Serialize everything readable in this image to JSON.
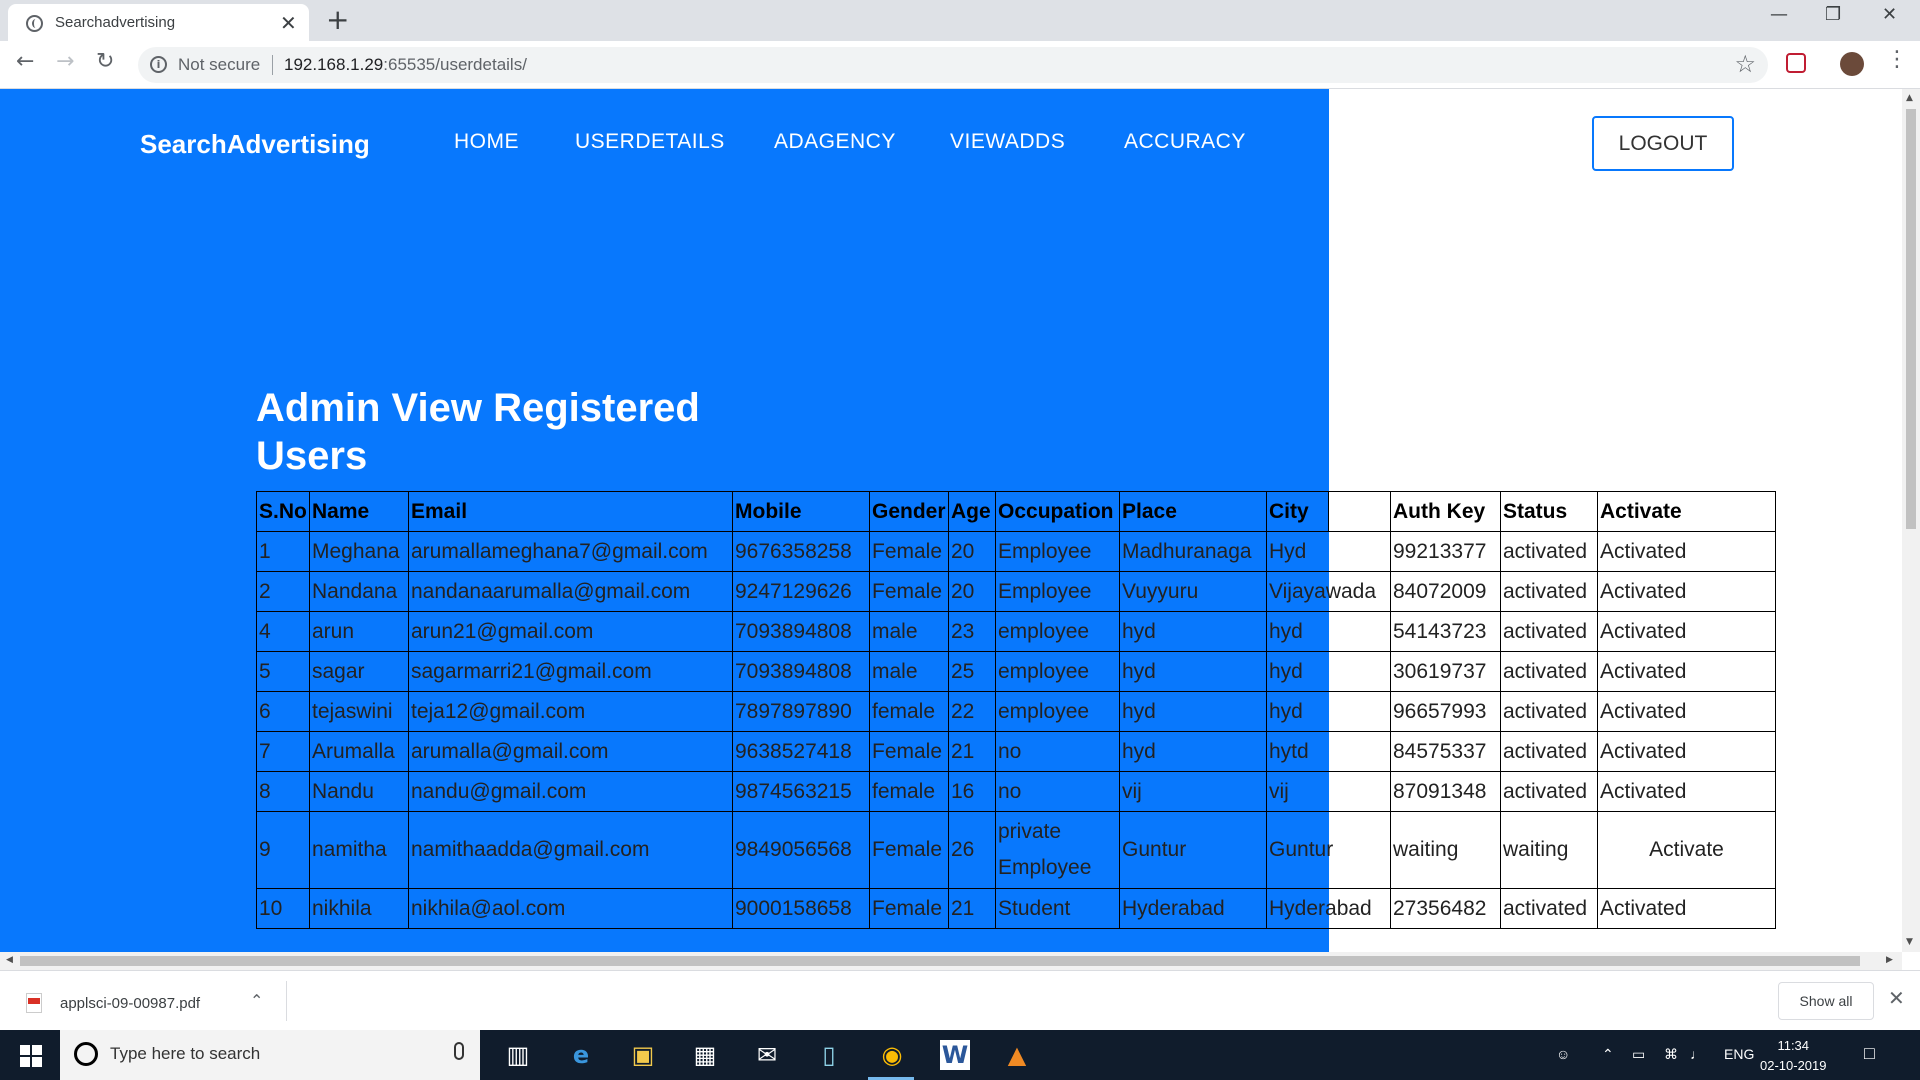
{
  "browser": {
    "tab_title": "Searchadvertising",
    "tab_close": "✕",
    "new_tab": "+",
    "not_secure": "Not secure",
    "url_host": "192.168.1.29",
    "url_rest": ":65535/userdetails/"
  },
  "site": {
    "brand": "SearchAdvertising",
    "nav": [
      "HOME",
      "USERDETAILS",
      "ADAGENCY",
      "VIEWADDS",
      "ACCURACY"
    ],
    "logout": "LOGOUT"
  },
  "page": {
    "heading": "Admin View Registered Users"
  },
  "table": {
    "headers": [
      "S.No",
      "Name",
      "Email",
      "Mobile",
      "Gender",
      "Age",
      "Occupation",
      "Place",
      "City",
      "",
      "Auth Key",
      "Status",
      "Activate"
    ],
    "rows": [
      [
        "1",
        "Meghana",
        "arumallameghana7@gmail.com",
        "9676358258",
        "Female",
        "20",
        "Employee",
        "Madhuranaga",
        "Hyd",
        "",
        "99213377",
        "activated",
        "Activated"
      ],
      [
        "2",
        "Nandana",
        "nandanaarumalla@gmail.com",
        "9247129626",
        "Female",
        "20",
        "Employee",
        "Vuyyuru",
        "Vijayawada",
        "",
        "84072009",
        "activated",
        "Activated"
      ],
      [
        "4",
        "arun",
        "arun21@gmail.com",
        "7093894808",
        "male",
        "23",
        "employee",
        "hyd",
        "hyd",
        "",
        "54143723",
        "activated",
        "Activated"
      ],
      [
        "5",
        "sagar",
        "sagarmarri21@gmail.com",
        "7093894808",
        "male",
        "25",
        "employee",
        "hyd",
        "hyd",
        "",
        "30619737",
        "activated",
        "Activated"
      ],
      [
        "6",
        "tejaswini",
        "teja12@gmail.com",
        "7897897890",
        "female",
        "22",
        "employee",
        "hyd",
        "hyd",
        "",
        "96657993",
        "activated",
        "Activated"
      ],
      [
        "7",
        "Arumalla",
        "arumalla@gmail.com",
        "9638527418",
        "Female",
        "21",
        "no",
        "hyd",
        "hytd",
        "",
        "84575337",
        "activated",
        "Activated"
      ],
      [
        "8",
        "Nandu",
        "nandu@gmail.com",
        "9874563215",
        "female",
        "16",
        "no",
        "vij",
        "vij",
        "",
        "87091348",
        "activated",
        "Activated"
      ],
      [
        "9",
        "namitha",
        "namithaadda@gmail.com",
        "9849056568",
        "Female",
        "26",
        "private Employee",
        "Guntur",
        "Guntur",
        "",
        "waiting",
        "waiting",
        "Activate"
      ],
      [
        "10",
        "nikhila",
        "nikhila@aol.com",
        "9000158658",
        "Female",
        "21",
        "Student",
        "Hyderabad",
        "Hyderabad",
        "",
        "27356482",
        "activated",
        "Activated"
      ]
    ]
  },
  "downloads": {
    "file": "applsci-09-00987.pdf",
    "show_all": "Show all"
  },
  "taskbar": {
    "search_placeholder": "Type here to search",
    "language": "ENG",
    "time": "11:34",
    "date": "02-10-2019"
  },
  "colors": {
    "hero_blue": "#0878fd",
    "taskbar": "#101c2c"
  }
}
